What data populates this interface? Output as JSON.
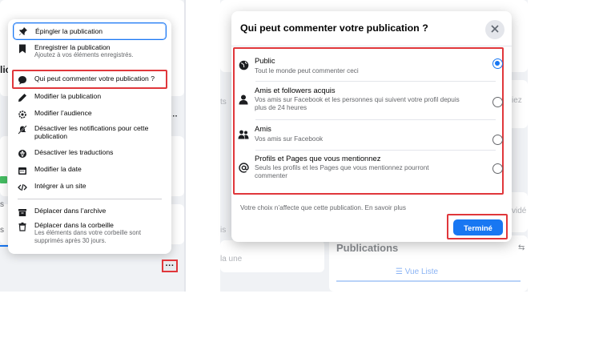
{
  "left_menu": {
    "items": [
      {
        "label": "Épingler la publication",
        "icon": "pin-icon"
      },
      {
        "label": "Enregistrer la publication",
        "sub": "Ajoutez à vos éléments enregistrés.",
        "icon": "bookmark-icon"
      },
      {
        "label": "Qui peut commenter votre publication ?",
        "icon": "comment-bubble-icon"
      },
      {
        "label": "Modifier la publication",
        "icon": "pencil-icon"
      },
      {
        "label": "Modifier l’audience",
        "icon": "gear-icon"
      },
      {
        "label": "Désactiver les notifications pour cette publication",
        "icon": "bell-off-icon"
      },
      {
        "label": "Désactiver les traductions",
        "icon": "globe-translate-icon"
      },
      {
        "label": "Modifier la date",
        "icon": "calendar-icon"
      },
      {
        "label": "Intégrer à un site",
        "icon": "code-icon"
      },
      {
        "label": "Déplacer dans l’archive",
        "icon": "archive-icon"
      },
      {
        "label": "Déplacer dans la corbeille",
        "sub": "Les éléments dans votre corbeille sont supprimés après 30 jours.",
        "icon": "trash-icon"
      }
    ],
    "more_button": "···"
  },
  "left_background": {
    "fragment_1": "lic",
    "fragment_2": "s",
    "fragment_3": "s",
    "dots": "···"
  },
  "dialog": {
    "title": "Qui peut commenter votre publication ?",
    "options": [
      {
        "label": "Public",
        "sub": "Tout le monde peut commenter ceci",
        "icon": "globe-icon",
        "selected": true
      },
      {
        "label": "Amis et followers acquis",
        "sub": "Vos amis sur Facebook et les personnes qui suivent votre profil depuis plus de 24 heures",
        "icon": "person-icon",
        "selected": false
      },
      {
        "label": "Amis",
        "sub": "Vos amis sur Facebook",
        "icon": "friends-icon",
        "selected": false
      },
      {
        "label": "Profils et Pages que vous mentionnez",
        "sub": "Seuls les profils et les Pages que vous mentionnez pourront commenter",
        "icon": "at-sign-icon",
        "selected": false
      }
    ],
    "footer_note": "Votre choix n’affecte que cette publication. En savoir plus",
    "done_label": "Terminé"
  },
  "right_background": {
    "frag_left_1": "ts",
    "frag_left_2": "is",
    "frag_left_3": "la une",
    "frag_right_1": "iez",
    "frag_right_2": "vidé",
    "section_title": "Publications",
    "tab_label": "☰ Vue Liste"
  },
  "colors": {
    "accent": "#1877f2",
    "highlight": "#e0373b",
    "page_bg": "#f0f2f5"
  }
}
